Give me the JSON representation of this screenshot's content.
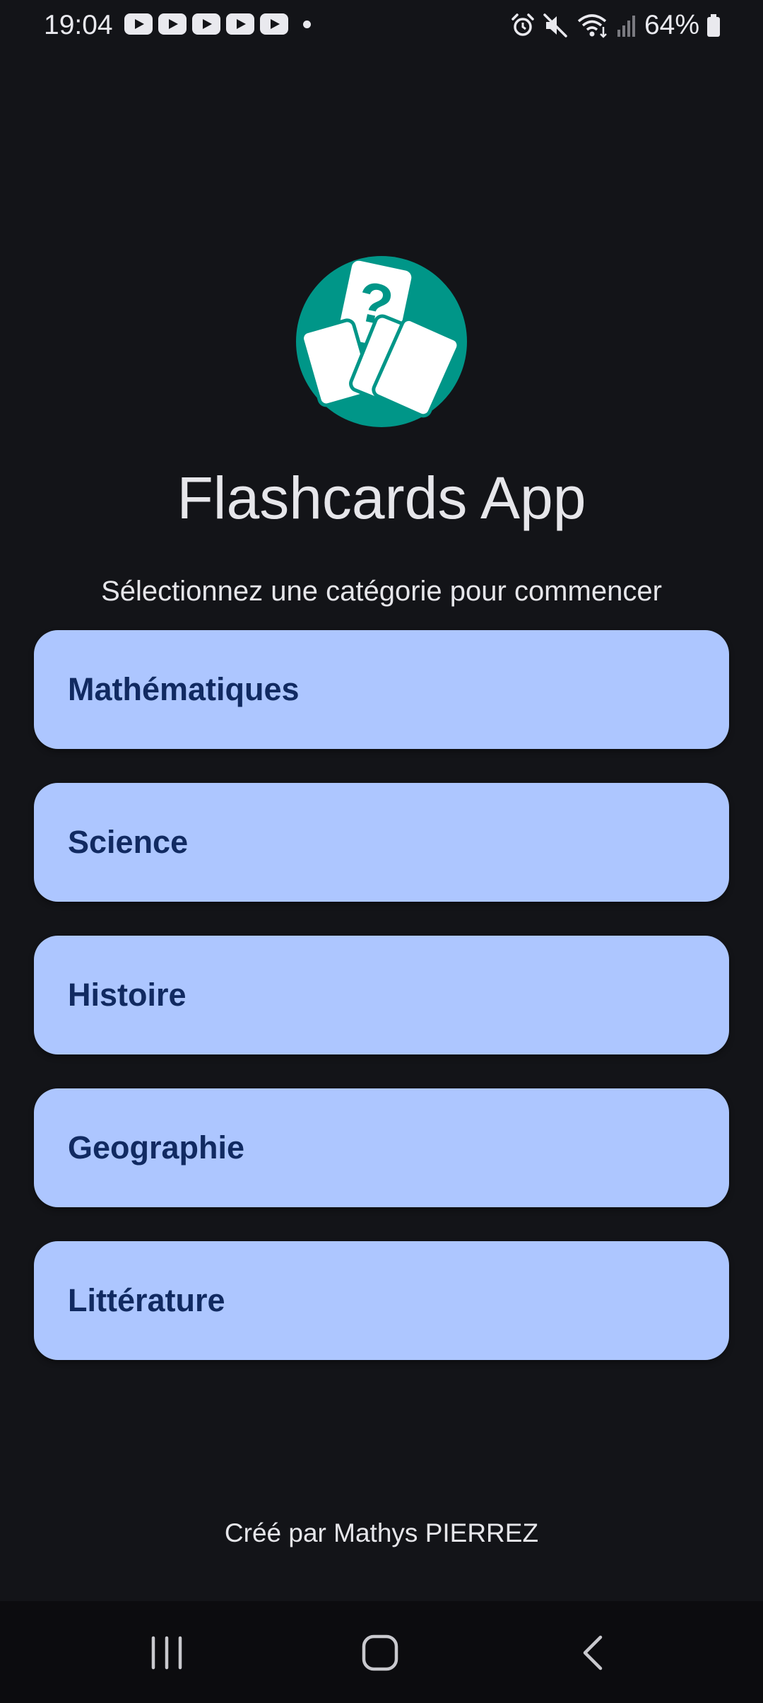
{
  "status_bar": {
    "time": "19:04",
    "notification_icons": [
      "youtube-icon",
      "youtube-icon",
      "youtube-icon",
      "youtube-icon",
      "youtube-icon"
    ],
    "right_icons": [
      "alarm-icon",
      "mute-icon",
      "wifi-icon",
      "signal-icon",
      "battery-icon"
    ],
    "battery_percent": "64%"
  },
  "app": {
    "logo_icon": "flashcards-logo-icon",
    "title": "Flashcards App",
    "subtitle": "Sélectionnez une catégorie pour commencer",
    "categories": [
      {
        "label": "Mathématiques"
      },
      {
        "label": "Science"
      },
      {
        "label": "Histoire"
      },
      {
        "label": "Geographie"
      },
      {
        "label": "Littérature"
      }
    ],
    "footer": "Créé par Mathys PIERREZ"
  },
  "nav_bar": {
    "icons": [
      "recent-apps-icon",
      "home-icon",
      "back-icon"
    ]
  },
  "colors": {
    "background": "#131418",
    "button_background": "#adc6ff",
    "button_text": "#112a61",
    "logo_accent": "#009688",
    "text": "#e6e6ea"
  }
}
